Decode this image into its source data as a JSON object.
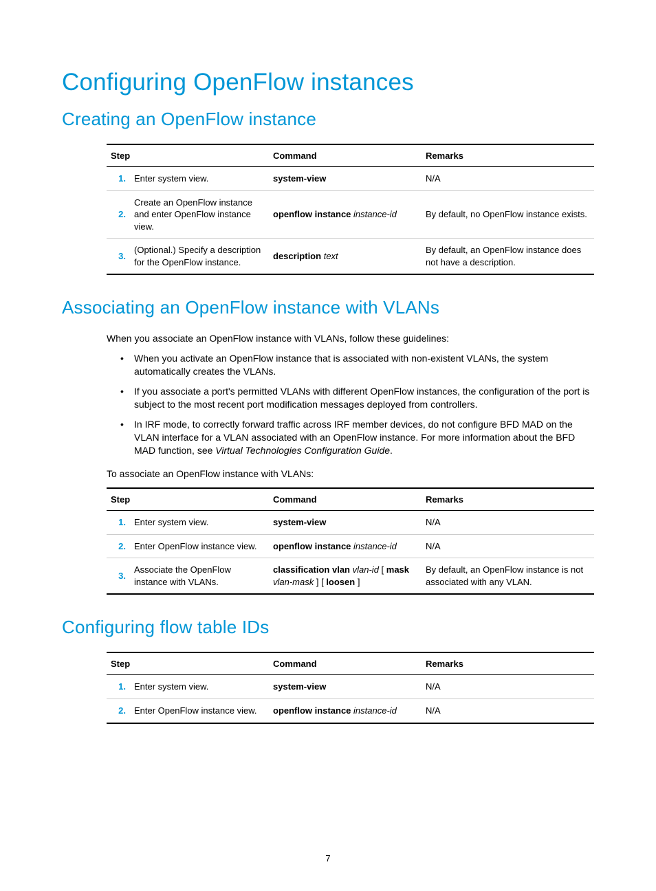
{
  "pageNumber": "7",
  "h1": "Configuring OpenFlow instances",
  "sections": {
    "s1": {
      "title": "Creating an OpenFlow instance",
      "tableHeaders": {
        "step": "Step",
        "command": "Command",
        "remarks": "Remarks"
      },
      "rows": [
        {
          "num": "1.",
          "desc": "Enter system view.",
          "cb": "system-view",
          "ci": "",
          "ct": "",
          "remarks": "N/A"
        },
        {
          "num": "2.",
          "desc": "Create an OpenFlow instance and enter OpenFlow instance view.",
          "cb": "openflow instance",
          "ci": "instance-id",
          "ct": "",
          "remarks": "By default, no OpenFlow instance exists."
        },
        {
          "num": "3.",
          "desc": "(Optional.) Specify a description for the OpenFlow instance.",
          "cb": "description",
          "ci": "text",
          "ct": "",
          "remarks": "By default, an OpenFlow instance does not have a description."
        }
      ]
    },
    "s2": {
      "title": "Associating an OpenFlow instance with VLANs",
      "intro": "When you associate an OpenFlow instance with VLANs, follow these guidelines:",
      "bullets": [
        "When you activate an OpenFlow instance that is associated with non-existent VLANs, the system automatically creates the VLANs.",
        "If you associate a port's permitted VLANs with different OpenFlow instances, the configuration of the port is subject to the most recent port modification messages deployed from controllers.",
        "In IRF mode, to correctly forward traffic across IRF member devices, do not configure BFD MAD on the VLAN interface for a VLAN associated with an OpenFlow instance. For more information about the BFD MAD function, see <i>Virtual Technologies Configuration Guide</i>."
      ],
      "lead2": "To associate an OpenFlow instance with VLANs:",
      "tableHeaders": {
        "step": "Step",
        "command": "Command",
        "remarks": "Remarks"
      },
      "rows": [
        {
          "num": "1.",
          "desc": "Enter system view.",
          "cmdHtml": "<b>system-view</b>",
          "remarks": "N/A"
        },
        {
          "num": "2.",
          "desc": "Enter OpenFlow instance view.",
          "cmdHtml": "<b>openflow instance</b> <i>instance-id</i>",
          "remarks": "N/A"
        },
        {
          "num": "3.",
          "desc": "Associate the OpenFlow instance with VLANs.",
          "cmdHtml": "<b>classification vlan</b> <i>vlan-id</i> [ <b>mask</b> <i>vlan-mask</i> ] [ <b>loosen</b> ]",
          "remarks": "By default, an OpenFlow instance is not associated with any VLAN."
        }
      ]
    },
    "s3": {
      "title": "Configuring flow table IDs",
      "tableHeaders": {
        "step": "Step",
        "command": "Command",
        "remarks": "Remarks"
      },
      "rows": [
        {
          "num": "1.",
          "desc": "Enter system view.",
          "cmdHtml": "<b>system-view</b>",
          "remarks": "N/A"
        },
        {
          "num": "2.",
          "desc": "Enter OpenFlow instance view.",
          "cmdHtml": "<b>openflow instance</b> <i>instance-id</i>",
          "remarks": "N/A"
        }
      ]
    }
  }
}
